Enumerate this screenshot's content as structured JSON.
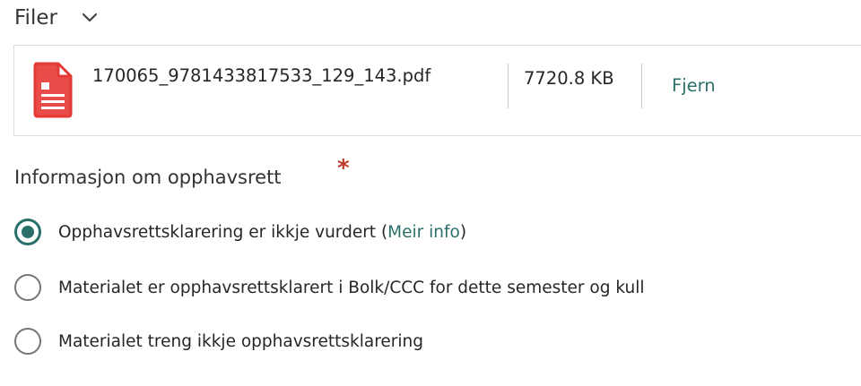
{
  "files": {
    "title": "Filer",
    "toggle_icon": "chevron-down-icon",
    "items": [
      {
        "icon": "pdf-file-icon",
        "name": "170065_9781433817533_129_143.pdf",
        "size": "7720.8 KB",
        "remove_label": "Fjern"
      }
    ]
  },
  "copyright": {
    "title": "Informasjon om opphavsrett",
    "required_mark": "*",
    "options": [
      {
        "label": "Opphavsrettsklarering er ikkje vurdert (",
        "link_text": "Meir info",
        "label_suffix": ")",
        "selected": true
      },
      {
        "label": "Materialet er opphavsrettsklarert i Bolk/CCC for dette semester og kull",
        "selected": false
      },
      {
        "label": "Materialet treng ikkje opphavsrettsklarering",
        "selected": false
      }
    ]
  },
  "colors": {
    "accent": "#2b6f6a",
    "required": "#c0392b",
    "pdf_icon": "#e53935",
    "border": "#dcdcdc"
  }
}
